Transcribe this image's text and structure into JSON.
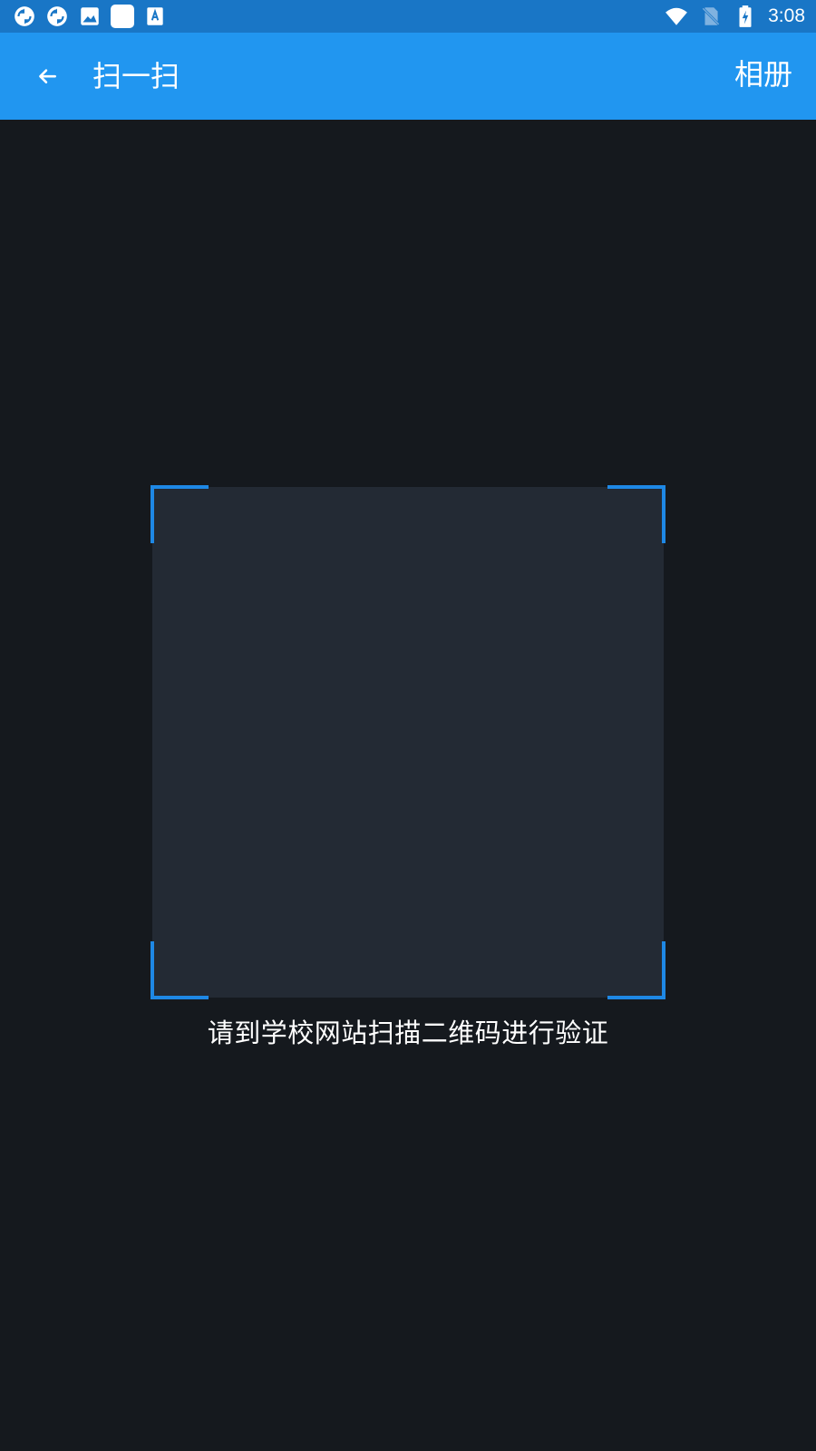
{
  "status_bar": {
    "time": "3:08",
    "left_icons": [
      "sync-icon",
      "sync-icon",
      "image-icon",
      "app-square-icon",
      "font-icon"
    ],
    "right_icons": [
      "wifi-icon",
      "no-sim-icon",
      "battery-charging-icon"
    ]
  },
  "app_bar": {
    "back_icon": "arrow-back-icon",
    "title": "扫一扫",
    "album_label": "相册"
  },
  "scanner": {
    "hint": "请到学校网站扫描二维码进行验证"
  },
  "colors": {
    "status_bar": "#1976c6",
    "app_bar": "#2196f0",
    "background": "#15191e",
    "scan_area": "#232a34",
    "corner_accent": "#1e88e5"
  }
}
